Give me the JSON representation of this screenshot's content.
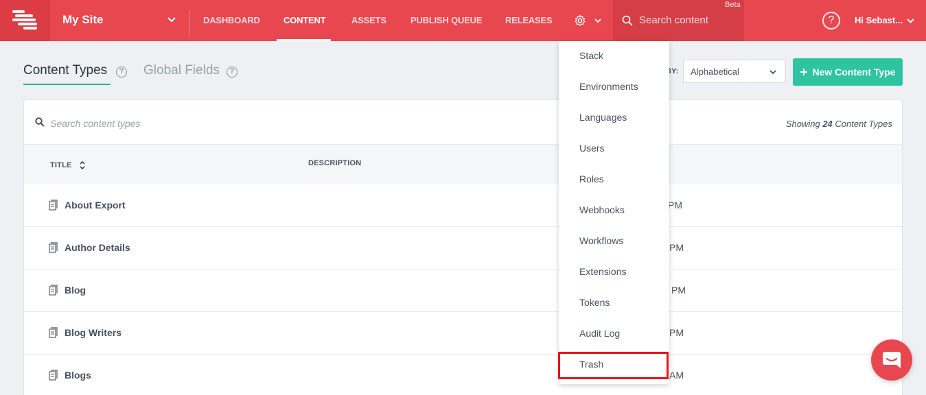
{
  "colors": {
    "brand_red": "#e8474f",
    "accent_green": "#2ec4a1",
    "highlight_red": "#e8121c"
  },
  "header": {
    "site_name": "My Site",
    "nav": [
      "DASHBOARD",
      "CONTENT",
      "ASSETS",
      "PUBLISH QUEUE",
      "RELEASES"
    ],
    "active_nav": "CONTENT",
    "search_placeholder": "Search content",
    "beta_label": "Beta",
    "help_glyph": "?",
    "user_greeting": "Hi Sebast..."
  },
  "subheader": {
    "tabs": [
      {
        "label": "Content Types",
        "active": true
      },
      {
        "label": "Global Fields",
        "active": false
      }
    ],
    "sort_by_label": "BY:",
    "sort_value": "Alphabetical",
    "new_button_label": "New Content Type"
  },
  "list": {
    "search_placeholder": "Search content types",
    "showing_prefix": "Showing",
    "showing_count": "24",
    "showing_suffix": "Content Types",
    "columns": [
      "TITLE",
      "DESCRIPTION"
    ],
    "rows": [
      {
        "title": "About Export",
        "modified_fragment": "PM"
      },
      {
        "title": "Author Details",
        "modified_fragment": "PM"
      },
      {
        "title": "Blog",
        "modified_fragment": "PM"
      },
      {
        "title": "Blog Writers",
        "modified_fragment": "PM"
      },
      {
        "title": "Blogs",
        "modified_fragment": "AM"
      }
    ]
  },
  "settings_menu": {
    "items": [
      "Stack",
      "Environments",
      "Languages",
      "Users",
      "Roles",
      "Webhooks",
      "Workflows",
      "Extensions",
      "Tokens",
      "Audit Log",
      "Trash"
    ],
    "highlighted_item": "Trash"
  }
}
